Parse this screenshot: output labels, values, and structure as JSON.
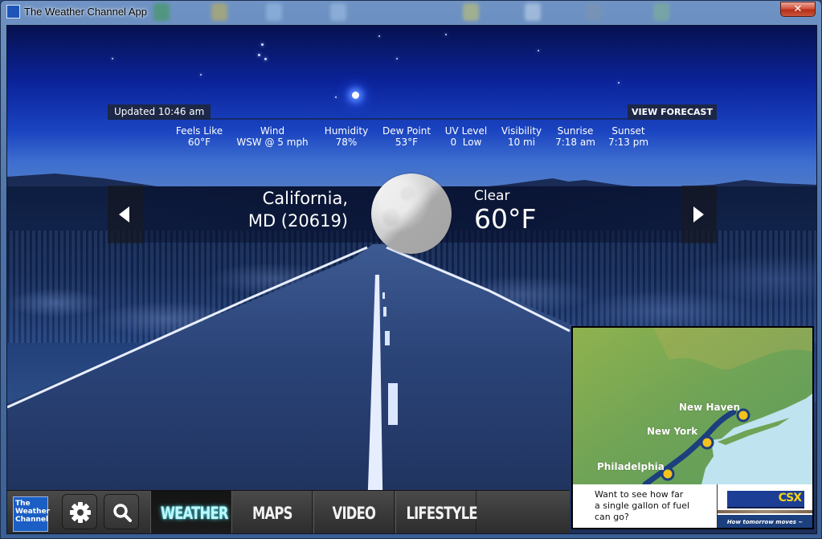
{
  "window": {
    "title": "The Weather Channel App",
    "close_label": "✕",
    "app_icon_text": "The Weather Channel"
  },
  "header": {
    "updated": "Updated 10:46 am",
    "view_forecast": "VIEW FORECAST"
  },
  "conditions": [
    {
      "label": "Feels Like",
      "value": "60°F"
    },
    {
      "label": "Wind",
      "value": "WSW @ 5 mph"
    },
    {
      "label": "Humidity",
      "value": "78%"
    },
    {
      "label": "Dew Point",
      "value": "53°F"
    },
    {
      "label": "UV Level",
      "value": "0  Low"
    },
    {
      "label": "Visibility",
      "value": "10 mi"
    },
    {
      "label": "Sunrise",
      "value": "7:18 am"
    },
    {
      "label": "Sunset",
      "value": "7:13 pm"
    }
  ],
  "current": {
    "location_line1": "California,",
    "location_line2": "MD (20619)",
    "icon": "moon-icon",
    "phrase": "Clear",
    "temperature": "60°F"
  },
  "nav": {
    "prev_icon": "chevron-left-icon",
    "next_icon": "chevron-right-icon"
  },
  "bottombar": {
    "logo_text": [
      "The",
      "Weather",
      "Channel"
    ],
    "settings_icon": "gear-icon",
    "search_icon": "search-icon",
    "tabs": [
      {
        "label": "WEATHER",
        "active": true
      },
      {
        "label": "MAPS",
        "active": false
      },
      {
        "label": "VIDEO",
        "active": false
      },
      {
        "label": "LIFESTYLE",
        "active": false
      }
    ],
    "accent_color": "#62e0ec"
  },
  "ad": {
    "cities": [
      "New Haven",
      "New York",
      "Philadelphia"
    ],
    "text": "Want to see how far\na single gallon of fuel\ncan go?",
    "brand": "CSX",
    "tagline": "How tomorrow moves ~"
  }
}
